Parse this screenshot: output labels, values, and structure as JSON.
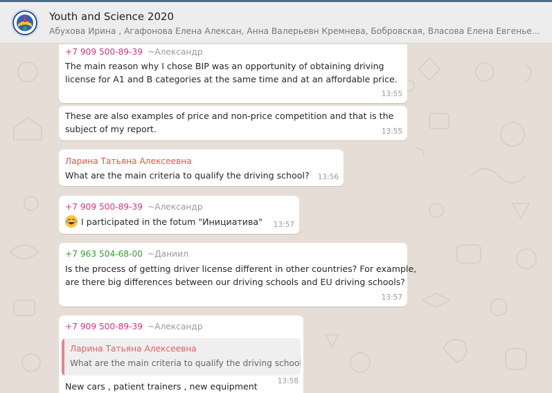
{
  "header": {
    "title": "Youth and Science 2020",
    "members": "Абухова Ирина , Агафонова Елена Алексан, Анна Валерьевн Кремнева, Бобровская, Власова Елена Евгеньевн, Ин..."
  },
  "messages": [
    {
      "sender": "+7 909 500-89-39",
      "nick": "~Александр",
      "line1": "The main reason why I chose BIP was an opportunity of obtaining driving",
      "line2": "license for A1 and B categories at the same time and at an affordable price.",
      "time": "13:55"
    },
    {
      "line1": "These are also examples of price and non-price competition and that is the",
      "line2": "subject of my report.",
      "time": "13:55"
    },
    {
      "sender": "Ларина Татьяна Алексеевна",
      "line1": "What are the main criteria to qualify the driving school?",
      "time": "13:56"
    },
    {
      "sender": "+7 909 500-89-39",
      "nick": "~Александр",
      "line1": "I participated in the fotum \"Инициатива\"",
      "emoji": "laughing-emoji",
      "time": "13:57"
    },
    {
      "sender": "+7 963 504-68-00",
      "nick": "~Даниил",
      "line1": "Is the process of getting driver license different in other countries? For example,",
      "line2": "are there big differences between our driving schools and EU driving schools?",
      "time": "13:57"
    },
    {
      "sender": "+7 909 500-89-39",
      "nick": "~Александр",
      "quote_sender": "Ларина Татьяна Алексеевна",
      "quote_text": "What are the main criteria to qualify the driving school?",
      "line1": "New cars , patient trainers , new equipment",
      "time": "13:58"
    }
  ]
}
